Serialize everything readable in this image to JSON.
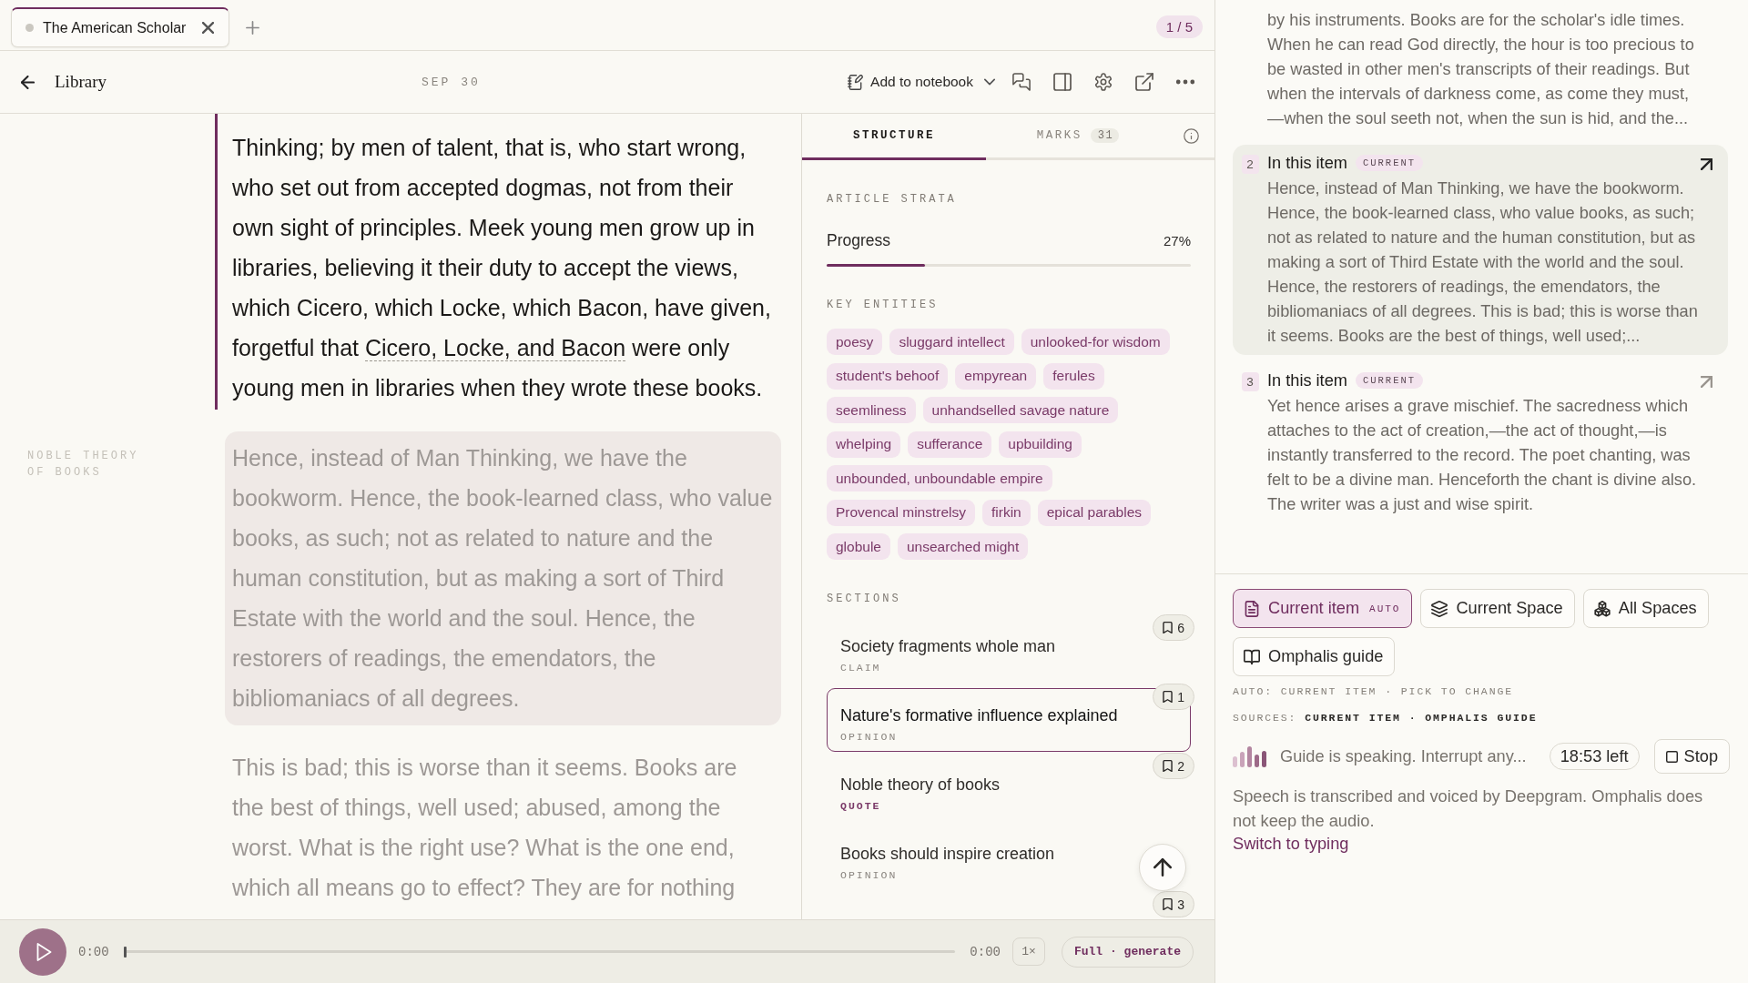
{
  "tabs": [
    {
      "title": "The American Scholar",
      "selected": true
    }
  ],
  "tab_counter": "1 / 5",
  "header": {
    "back_label": "Library",
    "date": "SEP 30",
    "notebook_button": "Add to notebook"
  },
  "reader": {
    "paragraphs": [
      {
        "current": true,
        "highlighted": false,
        "segments": [
          {
            "kind": "plain",
            "text": "Thinking; by men of talent, that is, who start wrong, who set out from accepted dogmas, not from their own sight of principles. Meek young men grow up in libraries, believing it their duty to accept the views, which Cicero, which Locke, which Bacon, have given, forgetful that "
          },
          {
            "kind": "annotation",
            "text": "Cicero, Locke, and Bacon"
          },
          {
            "kind": "plain",
            "text": " were only young men in libraries when they wrote these books."
          }
        ]
      },
      {
        "current": false,
        "highlighted": true,
        "margin_label": "NOBLE THEORY OF BOOKS",
        "segments": [
          {
            "kind": "plain",
            "text": "Hence, instead of Man Thinking, we have the bookworm. Hence, the book-learned class, who value books, as such; not as related to nature and the human constitution, but as making a sort of Third Estate with the world and the soul. Hence, the restorers of readings, the emendators, the bibliomaniacs of all degrees."
          }
        ]
      },
      {
        "current": false,
        "highlighted": false,
        "segments": [
          {
            "kind": "plain",
            "text": "This is bad; this is worse than it seems. Books are the best of things, well used; abused, among the worst. What is the right use? What is the one end, which all means go to effect? They are for nothing"
          }
        ]
      }
    ]
  },
  "structure_panel": {
    "tabs": [
      {
        "label": "STRUCTURE",
        "selected": true
      },
      {
        "label": "MARKS",
        "count": "31",
        "selected": false
      }
    ],
    "strata_heading": "ARTICLE STRATA",
    "progress": {
      "label": "Progress",
      "reading": "27%",
      "level": 0.27
    },
    "entities_heading": "KEY ENTITIES",
    "entities": [
      "poesy",
      "sluggard intellect",
      "unlooked-for wisdom",
      "student's behoof",
      "empyrean",
      "ferules",
      "seemliness",
      "unhandselled savage nature",
      "whelping",
      "sufferance",
      "upbuilding",
      "unbounded, unboundable empire",
      "Provencal minstrelsy",
      "firkin",
      "epical parables",
      "globule",
      "unsearched might"
    ],
    "sections_heading": "SECTIONS",
    "sections": [
      {
        "title": "Society fragments whole man",
        "type": "CLAIM",
        "kind": "claim",
        "marks": "6",
        "selected": false
      },
      {
        "title": "Nature's formative influence explained",
        "type": "OPINION",
        "kind": "opinion",
        "marks": "1",
        "selected": true
      },
      {
        "title": "Noble theory of books",
        "type": "QUOTE",
        "kind": "quote",
        "marks": "2",
        "selected": false
      },
      {
        "title": "Books should inspire creation",
        "type": "OPINION",
        "kind": "opinion",
        "selected": false
      },
      {
        "marks": "3"
      }
    ]
  },
  "results": [
    {
      "highlighted": false,
      "text": "by his instruments. Books are for the scholar's idle times. When he can read God directly, the hour is too precious to be wasted in other men's transcripts of their readings. But when the intervals of darkness come, as come they must,—when the soul seeth not, when the sun is hid, and the..."
    },
    {
      "highlighted": true,
      "number": "2",
      "title": "In this item",
      "tag": "CURRENT",
      "text": "Hence, instead of Man Thinking, we have the bookworm. Hence, the book-learned class, who value books, as such; not as related to nature and the human constitution, but as making a sort of Third Estate with the world and the soul. Hence, the restorers of readings, the emendators, the bibliomaniacs of all degrees. This is bad; this is worse than it seems. Books are the best of things, well used;..."
    },
    {
      "highlighted": false,
      "number": "3",
      "title": "In this item",
      "tag": "CURRENT",
      "text": "Yet hence arises a grave mischief. The sacredness which attaches to the act of creation,—the act of thought,—is instantly transferred to the record. The poet chanting, was felt to be a divine man. Henceforth the chant is divine also. The writer was a just and wise spirit."
    }
  ],
  "sources": [
    {
      "kind": "item",
      "label": "Current item",
      "badge": "AUTO",
      "selected": true
    },
    {
      "kind": "space",
      "label": "Current Space",
      "selected": false
    },
    {
      "kind": "all_spaces",
      "label": "All Spaces",
      "selected": false
    },
    {
      "kind": "guide",
      "label": "Omphalis guide",
      "selected": false
    }
  ],
  "source_hint": "AUTO: CURRENT ITEM · PICK TO CHANGE",
  "sources_line": "SOURCES: **CURRENT ITEM · OMPHALIS GUIDE**",
  "voice": {
    "status": "Guide is speaking. Interrupt any...",
    "time_left": "18:53 left",
    "stop_label": "Stop"
  },
  "privacy_note": "Speech is transcribed and voiced by Deepgram. Omphalis does not keep the audio.",
  "switch_link": "Switch to typing",
  "player": {
    "elapsed": "0:00",
    "level": 0,
    "duration": "0:00",
    "speed": "1×",
    "mode": "Full · generate"
  }
}
